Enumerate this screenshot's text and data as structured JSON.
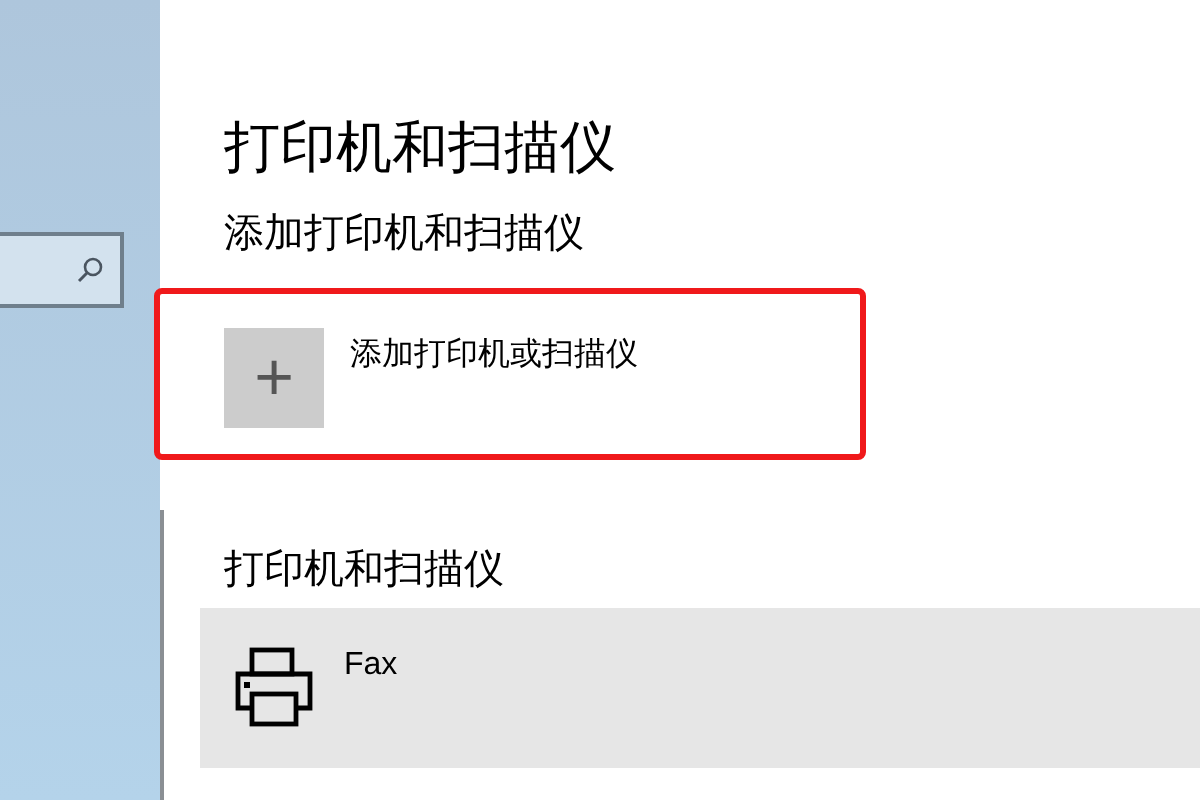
{
  "page_title": "打印机和扫描仪",
  "add_section": {
    "heading": "添加打印机和扫描仪",
    "add_button": {
      "icon": "+",
      "label": "添加打印机或扫描仪",
      "highlighted": true
    }
  },
  "devices_section": {
    "heading": "打印机和扫描仪",
    "devices": [
      {
        "name": "Fax",
        "selected": true
      }
    ]
  }
}
